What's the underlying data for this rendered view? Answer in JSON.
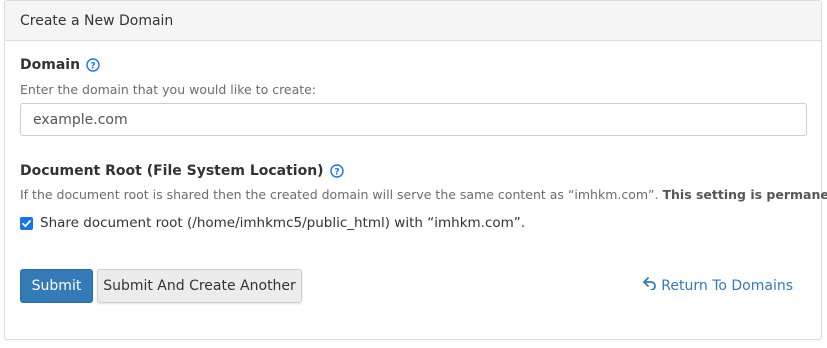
{
  "panel": {
    "title": "Create a New Domain"
  },
  "domain": {
    "label": "Domain",
    "help_icon": "question-circle-icon",
    "hint": "Enter the domain that you would like to create:",
    "value": "example.com"
  },
  "document_root": {
    "label": "Document Root (File System Location)",
    "help_icon": "question-circle-icon",
    "hint": "If the document root is shared then the created domain will serve the same content as “imhkm.com”.",
    "hint_strong": "This setting is permanent.",
    "share_checkbox_label": "Share document root (/home/imhkmc5/public_html) with “imhkm.com”.",
    "share_checked": true
  },
  "actions": {
    "submit_label": "Submit",
    "submit_another_label": "Submit And Create Another",
    "return_label": "Return To Domains",
    "return_icon": "undo-arrow-icon"
  },
  "colors": {
    "primary": "#337ab7",
    "link": "#337ab7",
    "help_icon": "#1a73e8",
    "checkbox": "#1a73e8"
  }
}
